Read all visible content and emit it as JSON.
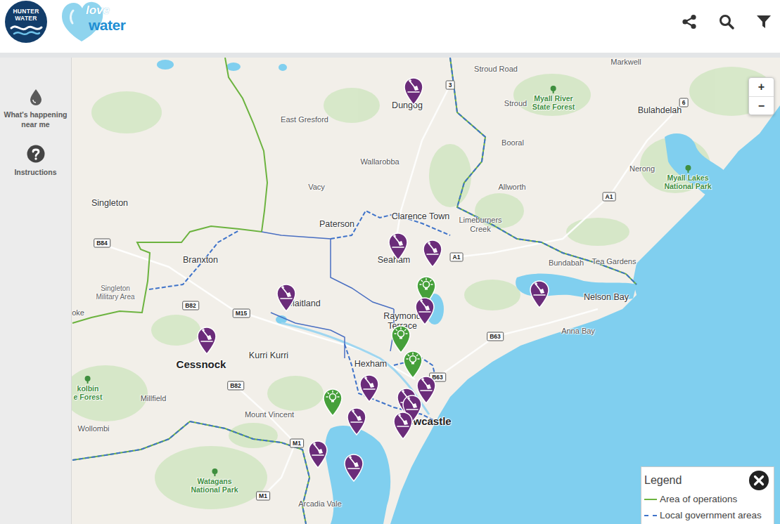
{
  "header": {
    "logo": [
      "HUNTER",
      "WATER"
    ],
    "brand": [
      "love",
      "water"
    ]
  },
  "sidebar": {
    "items": [
      {
        "lines": [
          "What's happening",
          "near me"
        ]
      },
      {
        "lines": [
          "Instructions"
        ]
      }
    ]
  },
  "map": {
    "places": [
      {
        "label": "Markwell",
        "kind": "locality"
      },
      {
        "label": "Stroud Road",
        "kind": "locality"
      },
      {
        "lines": [
          "Myall River",
          "State Forest"
        ],
        "kind": "park"
      },
      {
        "label": "Bulahdelah",
        "kind": "town"
      },
      {
        "label": "Dungog",
        "kind": "town"
      },
      {
        "label": "East Gresford",
        "kind": "locality"
      },
      {
        "label": "Stroud",
        "kind": "locality"
      },
      {
        "label": "Booral",
        "kind": "locality"
      },
      {
        "label": "Wallarobba",
        "kind": "locality"
      },
      {
        "label": "Nerong",
        "kind": "locality"
      },
      {
        "lines": [
          "Myall Lakes",
          "National Park"
        ],
        "kind": "park"
      },
      {
        "label": "Allworth",
        "kind": "locality"
      },
      {
        "label": "Vacy",
        "kind": "locality"
      },
      {
        "label": "Singleton",
        "kind": "town"
      },
      {
        "label": "Paterson",
        "kind": "town"
      },
      {
        "label": "Clarence Town",
        "kind": "town"
      },
      {
        "lines": [
          "Limeburners",
          "Creek"
        ],
        "kind": "locality"
      },
      {
        "label": "Bundabah",
        "kind": "locality"
      },
      {
        "label": "Tea Gardens",
        "kind": "locality"
      },
      {
        "label": "Seaham",
        "kind": "town"
      },
      {
        "label": "Branxton",
        "kind": "town"
      },
      {
        "label": "Nelson Bay",
        "kind": "town"
      },
      {
        "lines": [
          "Singleton",
          "Military Area"
        ],
        "kind": "area"
      },
      {
        "label": "Maitland",
        "kind": "town"
      },
      {
        "lines": [
          "Raymond",
          "Terrace"
        ],
        "kind": "town"
      },
      {
        "label": "oke",
        "kind": "locality"
      },
      {
        "label": "Anna Bay",
        "kind": "locality"
      },
      {
        "label": "Cessnock",
        "kind": "city"
      },
      {
        "label": "Kurri Kurri",
        "kind": "town"
      },
      {
        "label": "Hexham",
        "kind": "town"
      },
      {
        "lines": [
          "kolbin",
          "e Forest"
        ],
        "kind": "park"
      },
      {
        "label": "Millfield",
        "kind": "locality"
      },
      {
        "label": "Mount Vincent",
        "kind": "locality"
      },
      {
        "label": "Newcastle",
        "kind": "city"
      },
      {
        "label": "Wollombi",
        "kind": "locality"
      },
      {
        "lines": [
          "Watagans",
          "National Park"
        ],
        "kind": "park"
      },
      {
        "label": "Arcadia Vale",
        "kind": "locality"
      }
    ],
    "roads": [
      {
        "label": "3"
      },
      {
        "label": "6"
      },
      {
        "label": "A1"
      },
      {
        "label": "B84"
      },
      {
        "label": "A1"
      },
      {
        "label": "B82"
      },
      {
        "label": "M15"
      },
      {
        "label": "B63"
      },
      {
        "label": "B82"
      },
      {
        "label": "B63"
      },
      {
        "label": "M1"
      },
      {
        "label": "M1"
      }
    ],
    "pins": [
      {
        "kind": "works"
      },
      {
        "kind": "works"
      },
      {
        "kind": "works"
      },
      {
        "kind": "works"
      },
      {
        "kind": "works"
      },
      {
        "kind": "idea"
      },
      {
        "kind": "works"
      },
      {
        "kind": "works"
      },
      {
        "kind": "idea"
      },
      {
        "kind": "idea"
      },
      {
        "kind": "works"
      },
      {
        "kind": "works"
      },
      {
        "kind": "works"
      },
      {
        "kind": "idea"
      },
      {
        "kind": "works"
      },
      {
        "kind": "works"
      },
      {
        "kind": "works"
      },
      {
        "kind": "works"
      },
      {
        "kind": "works"
      }
    ],
    "zoom": {
      "in": "+",
      "out": "−"
    }
  },
  "legend": {
    "title": "Legend",
    "items": [
      {
        "label": "Area of operations",
        "kind": "solid",
        "color": "#6cb33f"
      },
      {
        "label": "Local government areas",
        "kind": "dashed",
        "color": "#3f73c9"
      }
    ]
  }
}
